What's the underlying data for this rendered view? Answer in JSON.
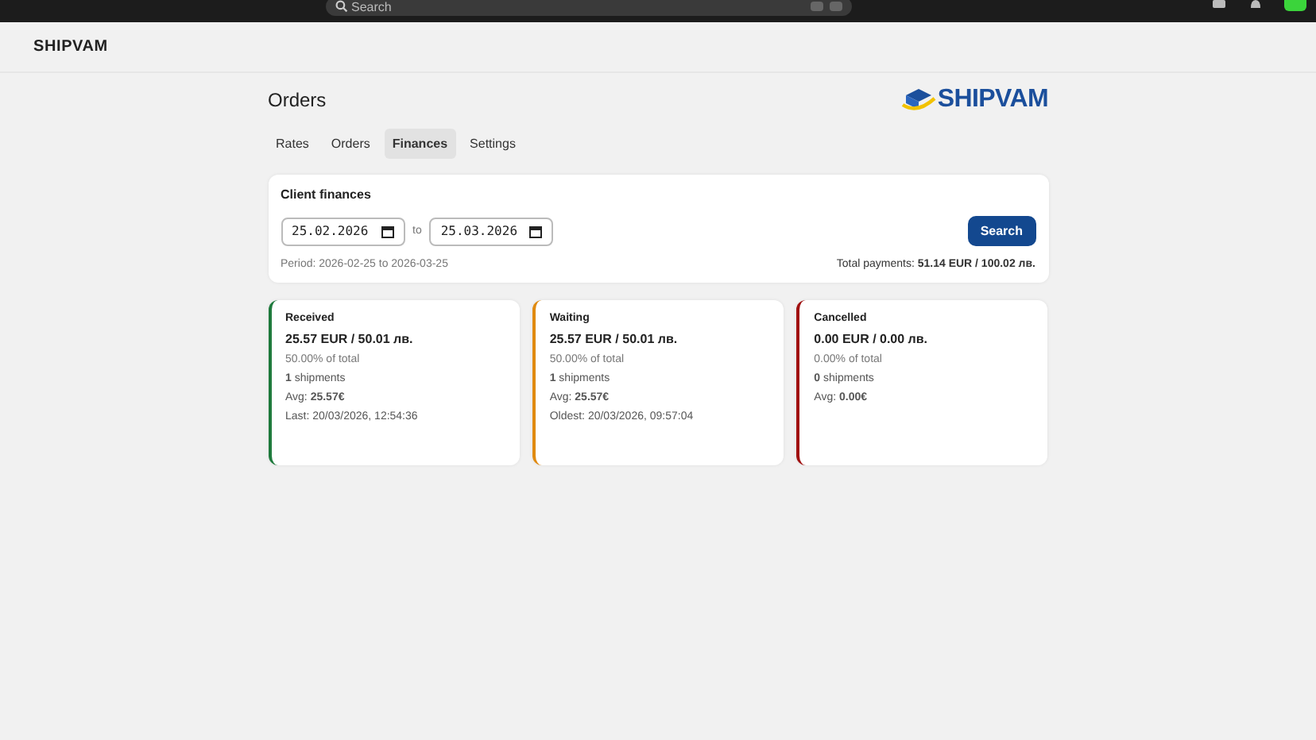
{
  "topbar": {
    "search": {
      "placeholder": "Search"
    }
  },
  "brand": "SHIPVAM",
  "page": {
    "title": "Orders",
    "logo_text": "SHIPVAM"
  },
  "tabs": [
    {
      "label": "Rates",
      "selected": false
    },
    {
      "label": "Orders",
      "selected": false
    },
    {
      "label": "Finances",
      "selected": true
    },
    {
      "label": "Settings",
      "selected": false
    }
  ],
  "filter": {
    "title": "Client finances",
    "from": "25.02.2026",
    "to_label": "to",
    "to": "25.03.2026",
    "button": "Search",
    "period": "Period: 2026-02-25 to 2026-03-25",
    "total": "Total payments: **51.14 EUR / 100.02 лв.**"
  },
  "cards": [
    {
      "title": "Received",
      "color": "#1e7a3c",
      "amount": "25.57 EUR / 50.01 лв.",
      "share": "50.00% of total",
      "shipments": "**1** shipments",
      "avg": "Avg: **25.57€**",
      "last": "Last: 20/03/2026, 12:54:36"
    },
    {
      "title": "Waiting",
      "color": "#e08a10",
      "amount": "25.57 EUR / 50.01 лв.",
      "share": "50.00% of total",
      "shipments": "**1** shipments",
      "avg": "Avg: **25.57€**",
      "last": "Oldest: 20/03/2026, 09:57:04"
    },
    {
      "title": "Cancelled",
      "color": "#a01010",
      "amount": "0.00 EUR / 0.00 лв.",
      "share": "0.00% of total",
      "shipments": "**0** shipments",
      "avg": "Avg: **0.00€**"
    }
  ]
}
